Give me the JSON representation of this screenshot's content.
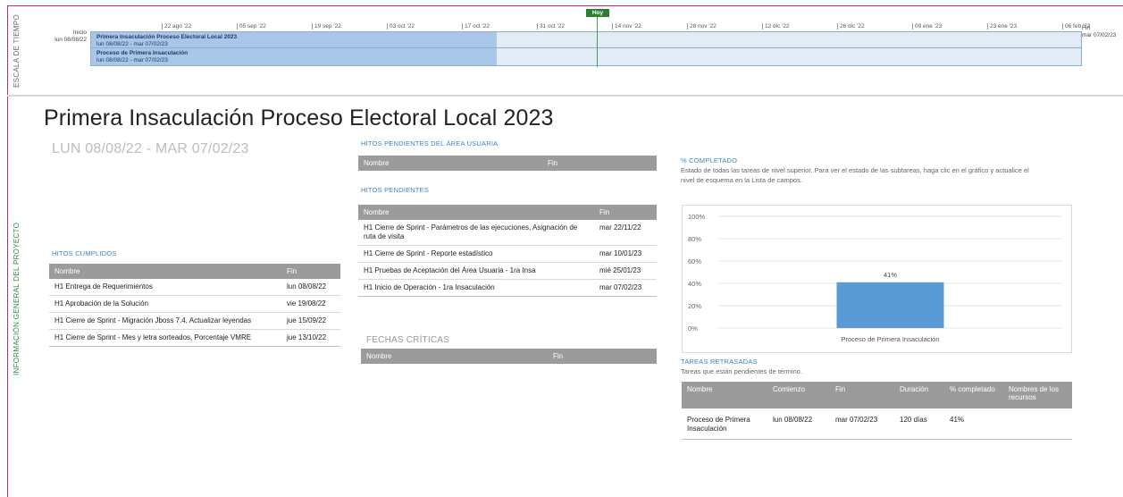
{
  "side_labels": {
    "timescale": "ESCALA DE TIEMPO",
    "project_info": "INFORMACIÓN GENERAL DEL PROYECTO"
  },
  "timeline": {
    "today_label": "Hoy",
    "start_label": "Inicio",
    "start_date": "lun 08/08/22",
    "end_label": "Fin",
    "end_date": "mar 07/02/23",
    "ticks": [
      "22 ago '22",
      "05 sep '22",
      "19 sep '22",
      "03 oct '22",
      "17 oct '22",
      "31 oct '22",
      "14 nov '22",
      "28 nov '22",
      "12 dic '22",
      "26 dic '22",
      "09 ene '23",
      "23 ene '23",
      "06 feb '23"
    ],
    "tasks": [
      {
        "name": "Primera Insaculación Proceso Electoral Local 2023",
        "dates": "lun 08/08/22 - mar 07/02/23"
      },
      {
        "name": "Proceso de Primera Insaculación",
        "dates": "lun 08/08/22 - mar 07/02/23"
      }
    ]
  },
  "title": "Primera Insaculación Proceso Electoral Local 2023",
  "date_range": "LUN 08/08/22 - MAR 07/02/23",
  "hitos_cumplidos": {
    "heading": "HITOS CUMPLIDOS",
    "columns": [
      "Nombre",
      "Fin"
    ],
    "rows": [
      [
        "H1 Entrega de Requerimientos",
        "lun 08/08/22"
      ],
      [
        "H1 Aprobación de la Solución",
        "vie 19/08/22"
      ],
      [
        "H1 Cierre de Sprint - Migración Jboss 7.4, Actualizar leyendas",
        "jue 15/09/22"
      ],
      [
        "H1 Cierre de Sprint - Mes y letra sorteados, Porcentaje VMRE",
        "jue 13/10/22"
      ]
    ]
  },
  "hitos_usuaria": {
    "heading": "HITOS PENDIENTES DEL ÁREA USUARIA",
    "columns": [
      "Nombre",
      "Fin"
    ]
  },
  "hitos_pendientes": {
    "heading": "HITOS PENDIENTES",
    "columns": [
      "Nombre",
      "Fin"
    ],
    "rows": [
      [
        "H1 Cierre de Sprint - Parámetros de las ejecuciones, Asignación de ruta de visita",
        "mar 22/11/22"
      ],
      [
        "H1 Cierre de Sprint - Reporte estadístico",
        "mar 10/01/23"
      ],
      [
        "H1 Pruebas de Aceptación del Área Usuaria - 1ra Insa",
        "mié 25/01/23"
      ],
      [
        "H1 Inicio de Operación - 1ra Insaculación",
        "mar 07/02/23"
      ]
    ]
  },
  "fechas_criticas": {
    "heading": "FECHAS CRÍTICAS",
    "columns": [
      "Nombre",
      "Fin"
    ]
  },
  "completado": {
    "heading": "% COMPLETADO",
    "description": "Estado de todas las tareas de nivel superior. Para ver el estado de las subtareas, haga clic en el gráfico y actualice el nivel de esquema en la Lista de campos."
  },
  "chart_data": {
    "type": "bar",
    "categories": [
      "Proceso de Primera Insaculación"
    ],
    "values": [
      41
    ],
    "data_labels": [
      "41%"
    ],
    "ylim": [
      0,
      100
    ],
    "yticks": [
      "0%",
      "20%",
      "40%",
      "60%",
      "80%",
      "100%"
    ],
    "grid": true,
    "color": "#5b9bd5"
  },
  "tareas_retrasadas": {
    "heading": "TAREAS RETRASADAS",
    "description": "Tareas que están pendientes de término.",
    "columns": [
      "Nombre",
      "Comienzo",
      "Fin",
      "Duración",
      "% completado",
      "Nombres de los recursos"
    ],
    "rows": [
      [
        "Proceso de Primera Insaculación",
        "lun 08/08/22",
        "mar 07/02/23",
        "120 días",
        "41%",
        ""
      ]
    ]
  },
  "colors": {
    "frame": "#c0287b",
    "accent_blue": "#3d83c7",
    "table_header": "#9b9b9b",
    "today": "#2e7d32"
  }
}
